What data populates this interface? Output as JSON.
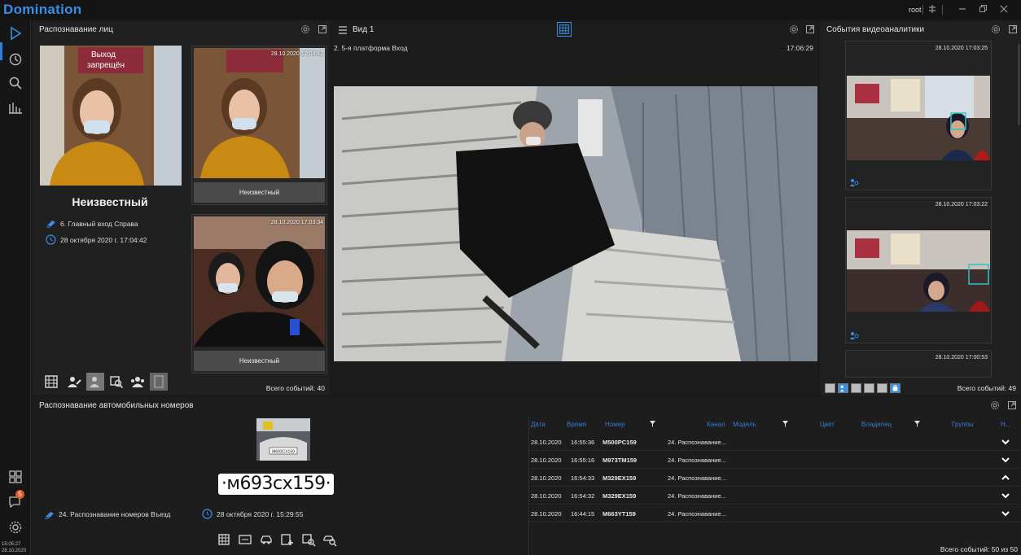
{
  "app": {
    "title": "Domination",
    "user": "root"
  },
  "rail": {
    "clock_time": "15:05:27",
    "clock_date": "28.10.2020",
    "notifications": "5"
  },
  "face_panel": {
    "title": "Распознавание лиц",
    "name": "Неизвестный",
    "camera": "6. Главный вход Справа",
    "time": "28 октября 2020 г. 17:04:42",
    "sign_text_1": "Выход",
    "sign_text_2": "запрещён",
    "cards": [
      {
        "time": "28.10.2020 17:04:42",
        "label": "Неизвестный"
      },
      {
        "time": "28.10.2020 17:03:34",
        "label": "Неизвестный"
      }
    ],
    "total": "Всего событий: 40"
  },
  "view_panel": {
    "title": "Вид 1",
    "camera": "2. 5-я платформа Вход",
    "clock": "17:06:29"
  },
  "events_panel": {
    "title": "События видеоаналитики",
    "cards": [
      {
        "time": "28.10.2020 17:03:25"
      },
      {
        "time": "28.10.2020 17:03:22"
      },
      {
        "time": "28.10.2020 17:00:53"
      }
    ],
    "total": "Всего событий: 49"
  },
  "plates_panel": {
    "title": "Распознавание автомобильных номеров",
    "photo_plate": "M693CX159",
    "plate": "·м693сх159·",
    "camera": "24. Распознавание номеров Въезд",
    "time": "28 октября 2020 г. 15:29:55",
    "columns": [
      "Дата",
      "Время",
      "Номер",
      "Канал",
      "Модель",
      "Цвет",
      "Владелец",
      "Группы",
      "Н..."
    ],
    "rows": [
      {
        "date": "28.10.2020",
        "time": "16:55:36",
        "plate": "M500PC159",
        "channel": "24. Распознавание...",
        "expanded": false
      },
      {
        "date": "28.10.2020",
        "time": "16:55:16",
        "plate": "M973TM159",
        "channel": "24. Распознавание...",
        "expanded": false
      },
      {
        "date": "28.10.2020",
        "time": "16:54:33",
        "plate": "M329EX159",
        "channel": "24. Распознавание...",
        "expanded": true
      },
      {
        "date": "28.10.2020",
        "time": "16:54:32",
        "plate": "M329EX159",
        "channel": "24. Распознавание...",
        "expanded": false
      },
      {
        "date": "28.10.2020",
        "time": "16:44:15",
        "plate": "M663YT159",
        "channel": "24. Распознавание...",
        "expanded": false
      }
    ],
    "total": "Всего событий: 50 из 50"
  },
  "colors": {
    "accent": "#3a8ee6",
    "badge": "#e05a2a",
    "highlight_box": "#2bc4c4"
  }
}
